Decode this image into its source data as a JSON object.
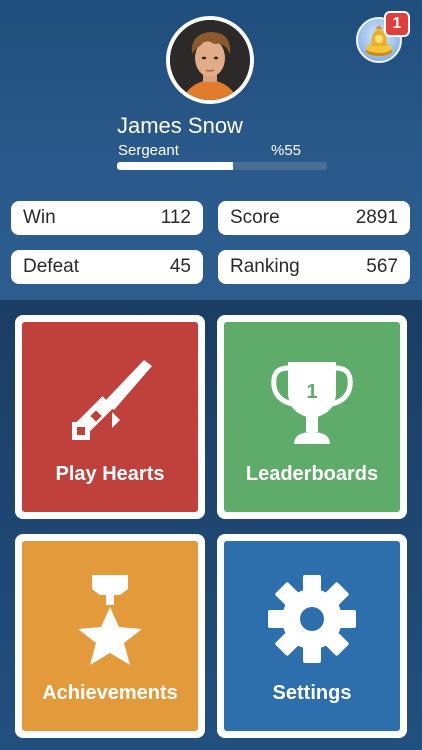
{
  "profile": {
    "name": "James Snow",
    "rank": "Sergeant",
    "progress_label": "%55",
    "progress_value": 0.55
  },
  "notifications": {
    "count": "1"
  },
  "stats": [
    {
      "label": "Win",
      "value": "112"
    },
    {
      "label": "Score",
      "value": "2891"
    },
    {
      "label": "Defeat",
      "value": "45"
    },
    {
      "label": "Ranking",
      "value": "567"
    }
  ],
  "tiles": [
    {
      "label": "Play Hearts",
      "icon": "sword-icon",
      "color": "#c0403b"
    },
    {
      "label": "Leaderboards",
      "icon": "trophy-icon",
      "color": "#5fab6a",
      "trophy_number": "1"
    },
    {
      "label": "Achievements",
      "icon": "medal-icon",
      "color": "#e39a3b"
    },
    {
      "label": "Settings",
      "icon": "gear-icon",
      "color": "#2d6fad"
    }
  ]
}
